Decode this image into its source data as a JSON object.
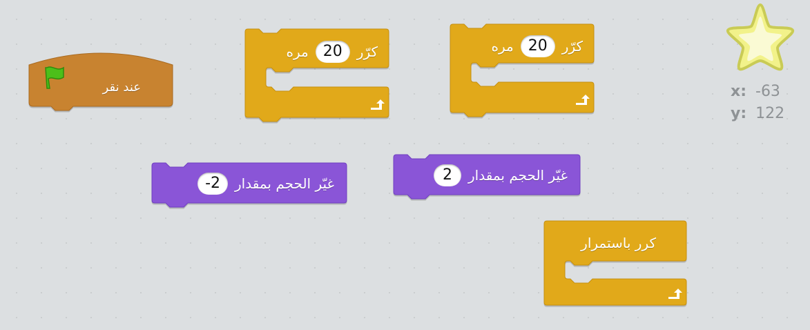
{
  "hat_block": {
    "label": "عند نقر",
    "icon": "green-flag-icon"
  },
  "repeat_blocks": [
    {
      "label": "كرّر",
      "count": "20",
      "suffix": "مره"
    },
    {
      "label": "كرّر",
      "count": "20",
      "suffix": "مره"
    }
  ],
  "size_blocks": [
    {
      "label": "غيّر الحجم بمقدار",
      "value": "-2"
    },
    {
      "label": "غيّر الحجم بمقدار",
      "value": "2"
    }
  ],
  "forever_block": {
    "label": "كرر باستمرار"
  },
  "sprite_position": {
    "x_label": "x:",
    "x_value": "-63",
    "y_label": "y:",
    "y_value": "122",
    "icon": "star-sprite-icon"
  },
  "colors": {
    "events": "#c88330",
    "control": "#e1a91a",
    "looks": "#8a55d7",
    "flag": "#4cbf1a",
    "star": "#f2f28a"
  }
}
